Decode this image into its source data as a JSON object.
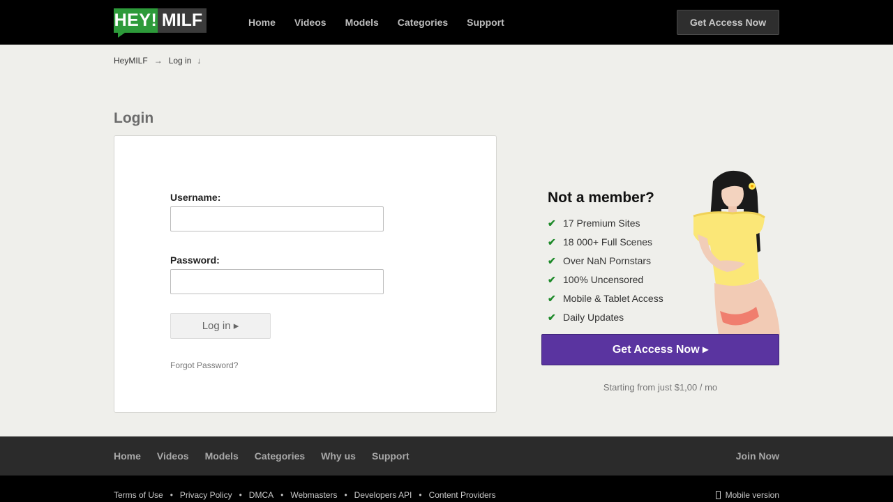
{
  "header": {
    "logo": {
      "part1": "HEY!",
      "part2": "MILF"
    },
    "nav": [
      "Home",
      "Videos",
      "Models",
      "Categories",
      "Support"
    ],
    "cta": "Get Access Now"
  },
  "breadcrumb": {
    "home": "HeyMILF",
    "arrow": "→",
    "current": "Log in",
    "down": "↓"
  },
  "page_title": "Login",
  "login_form": {
    "username_label": "Username:",
    "username_value": "",
    "password_label": "Password:",
    "password_value": "",
    "submit_label": "Log in ▸",
    "forgot_label": "Forgot Password?"
  },
  "promo": {
    "title": "Not a member?",
    "benefits": [
      "17 Premium Sites",
      "18 000+ Full Scenes",
      "Over NaN Pornstars",
      "100% Uncensored",
      "Mobile & Tablet Access",
      "Daily Updates"
    ],
    "cta": "Get Access Now ▸",
    "pricing": "Starting from just $1,00 / mo"
  },
  "footer": {
    "nav": [
      "Home",
      "Videos",
      "Models",
      "Categories",
      "Why us",
      "Support"
    ],
    "join": "Join Now",
    "legal": [
      "Terms of Use",
      "Privacy Policy",
      "DMCA",
      "Webmasters",
      "Developers API",
      "Content Providers"
    ],
    "separator": "•",
    "mobile": "Mobile version"
  },
  "colors": {
    "brand_green": "#2d9a3a",
    "cta_purple": "#5a34a0",
    "check_green": "#1e8a2a",
    "page_bg": "#efefeb"
  }
}
